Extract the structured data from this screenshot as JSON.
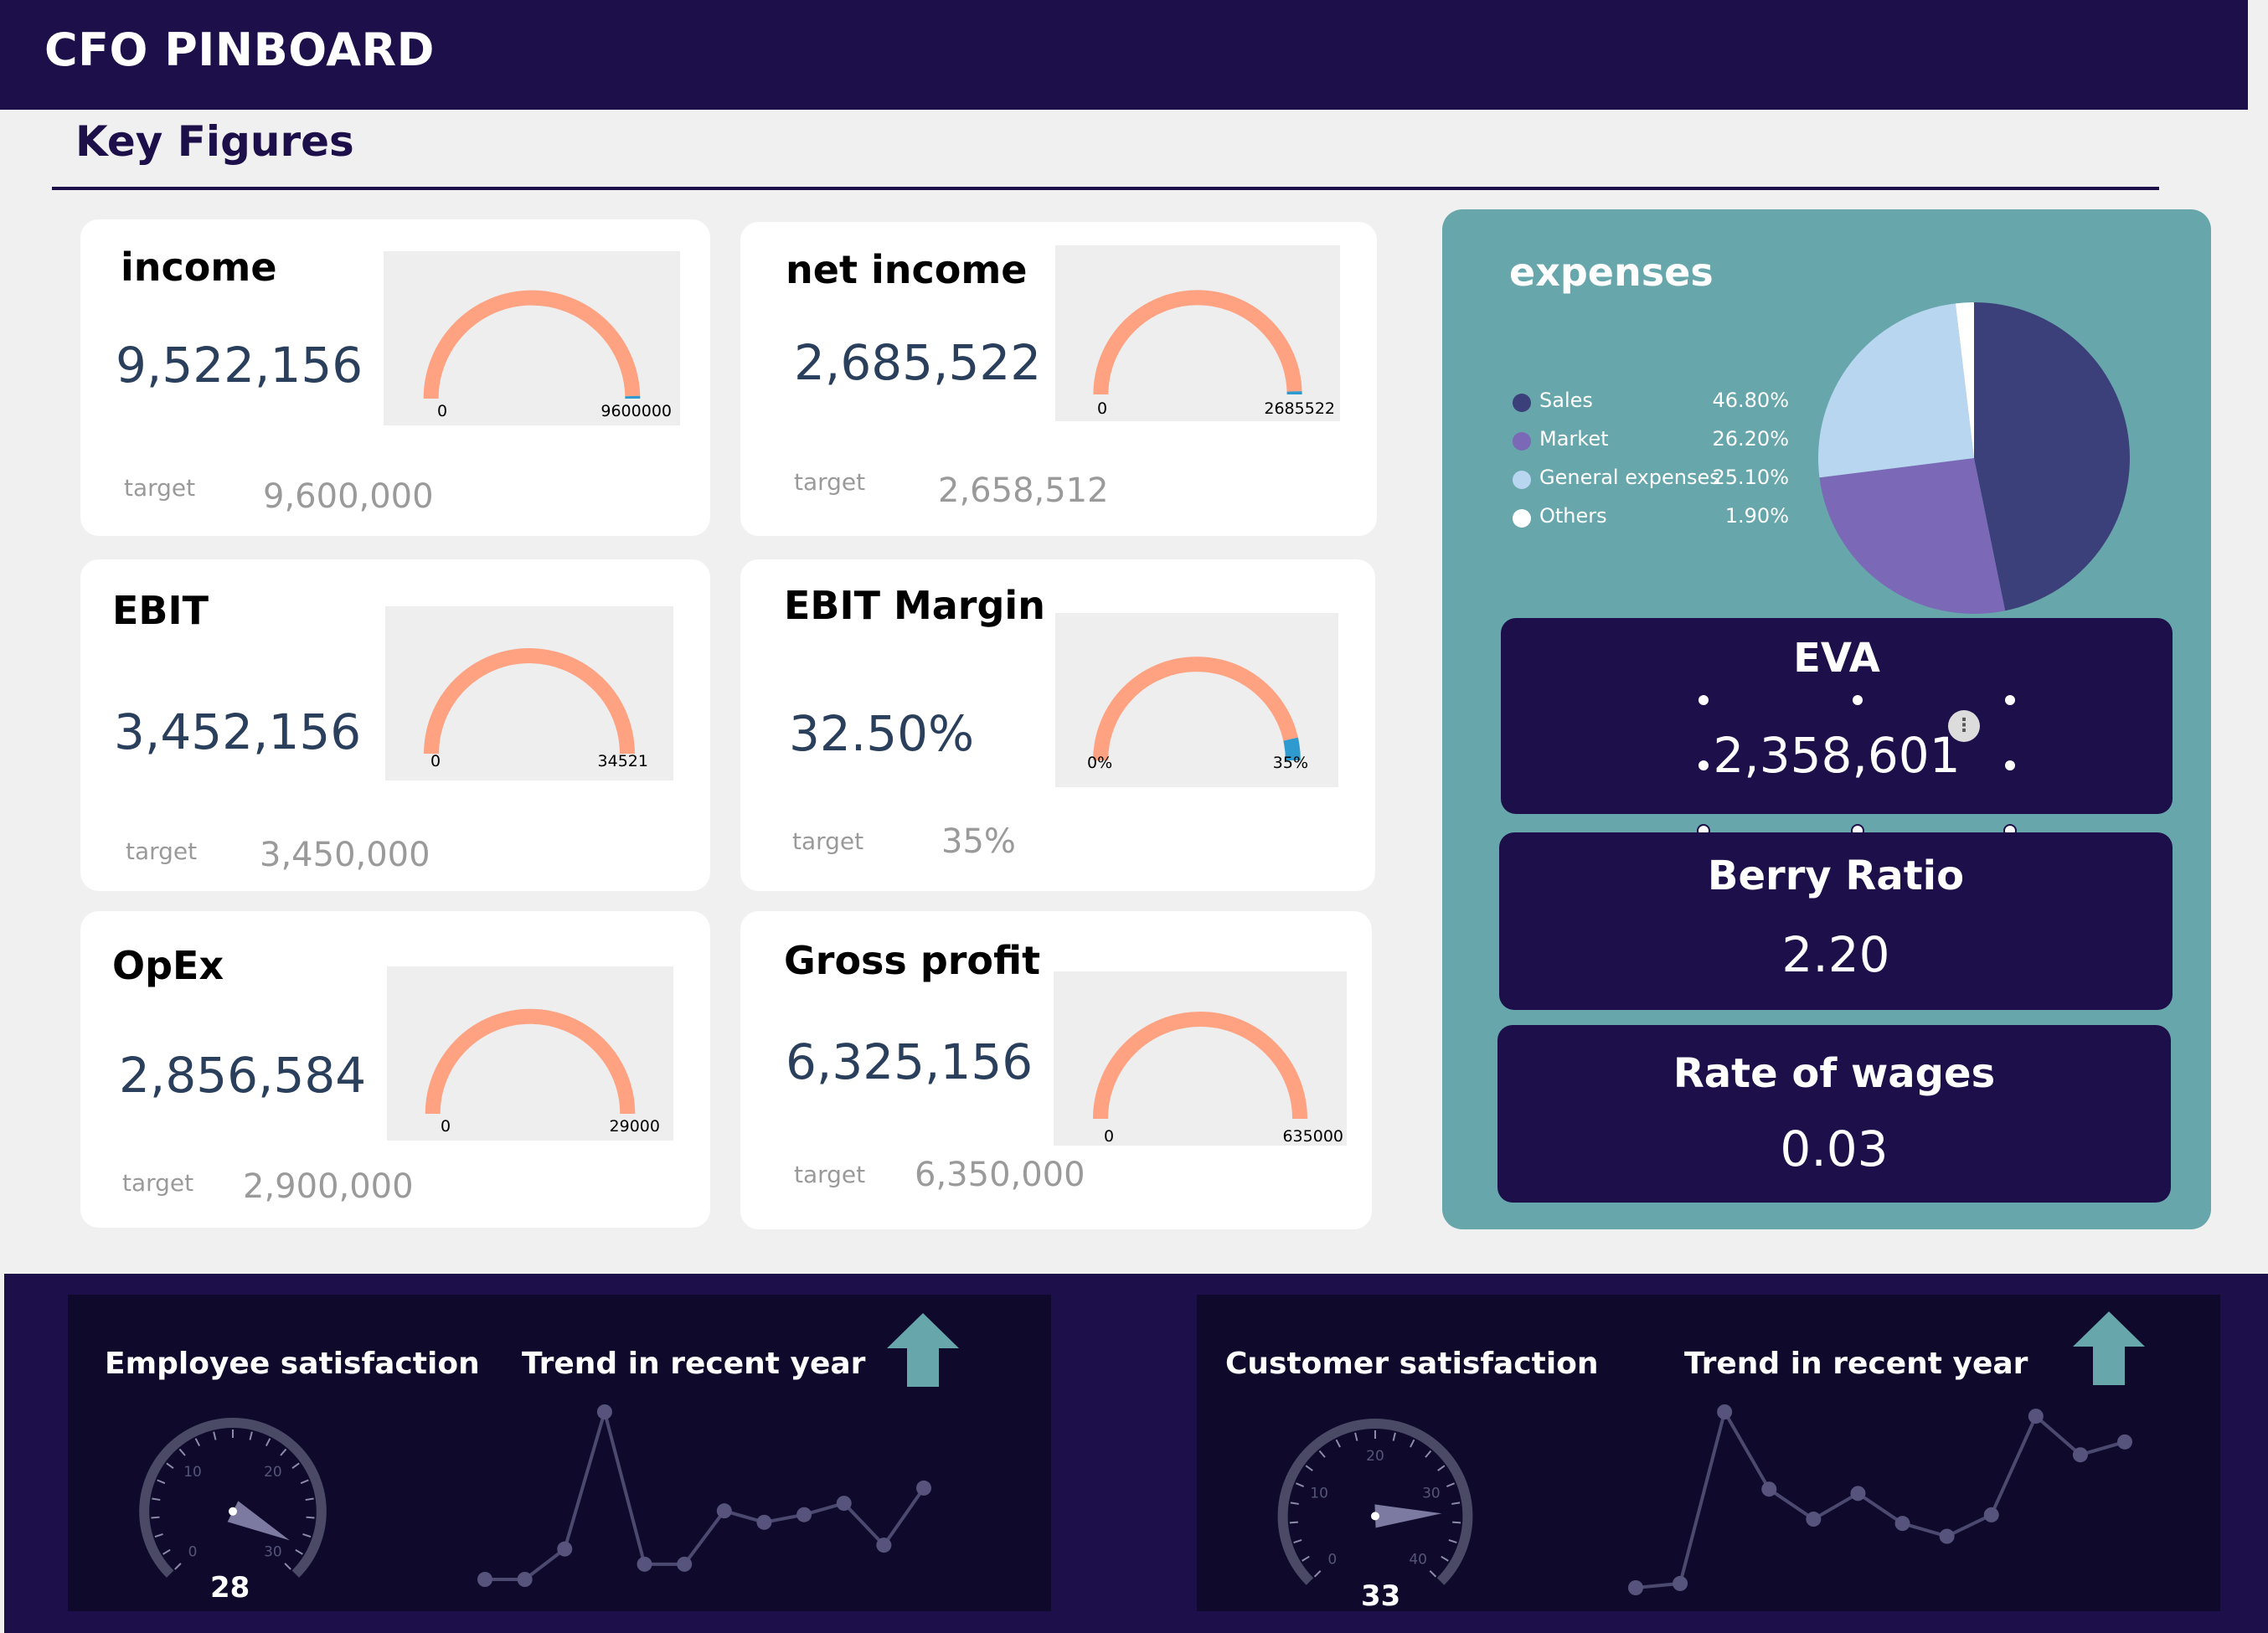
{
  "header": {
    "title": "CFO PINBOARD"
  },
  "section": {
    "title": "Key Figures"
  },
  "kpis": [
    {
      "title": "income",
      "value": "9,522,156",
      "target_label": "target",
      "target": "9,600,000",
      "gauge_min": "0",
      "gauge_max": "9600000",
      "progress": 0.992
    },
    {
      "title": "net income",
      "value": "2,685,522",
      "target_label": "target",
      "target": "2,658,512",
      "gauge_min": "0",
      "gauge_max": "2685522",
      "progress": 0.99
    },
    {
      "title": "EBIT",
      "value": "3,452,156",
      "target_label": "target",
      "target": "3,450,000",
      "gauge_min": "0",
      "gauge_max": "34521",
      "progress": 1.0
    },
    {
      "title": "EBIT Margin",
      "value": "32.50%",
      "target_label": "target",
      "target": "35%",
      "gauge_min": "0%",
      "gauge_max": "35%",
      "progress": 0.929
    },
    {
      "title": "OpEx",
      "value": "2,856,584",
      "target_label": "target",
      "target": "2,900,000",
      "gauge_min": "0",
      "gauge_max": "29000",
      "progress": 1.0
    },
    {
      "title": "Gross profit",
      "value": "6,325,156",
      "target_label": "target",
      "target": "6,350,000",
      "gauge_min": "0",
      "gauge_max": "635000",
      "progress": 1.0
    }
  ],
  "expenses": {
    "title": "expenses",
    "items": [
      {
        "label": "Sales",
        "pct": "46.80%",
        "value": 46.8,
        "color": "#3b3f7a"
      },
      {
        "label": "Market",
        "pct": "26.20%",
        "value": 26.2,
        "color": "#7b68b6"
      },
      {
        "label": "General expenses",
        "pct": "25.10%",
        "value": 25.1,
        "color": "#b9d6f0"
      },
      {
        "label": "Others",
        "pct": "1.90%",
        "value": 1.9,
        "color": "#ffffff"
      }
    ]
  },
  "metrics": {
    "eva": {
      "title": "EVA",
      "value": "2,358,601",
      "more_icon": "⋮"
    },
    "berry": {
      "title": "Berry Ratio",
      "value": "2.20"
    },
    "wages": {
      "title": "Rate of wages",
      "value": "0.03"
    }
  },
  "employee": {
    "title": "Employee satisfaction",
    "trend_title": "Trend in recent year",
    "value": "28",
    "dial_value": 28,
    "dial_min": 0,
    "dial_max": 30,
    "ticks": [
      "0",
      "10",
      "20",
      "30"
    ],
    "trend_icon": "arrow-up-icon",
    "trend": [
      4,
      4,
      12,
      48,
      8,
      8,
      22,
      19,
      21,
      24,
      13,
      28
    ]
  },
  "customer": {
    "title": "Customer satisfaction",
    "trend_title": "Trend in recent year",
    "value": "33",
    "dial_value": 33,
    "dial_min": 0,
    "dial_max": 40,
    "ticks": [
      "0",
      "10",
      "20",
      "30",
      "40"
    ],
    "trend_icon": "arrow-up-icon",
    "trend": [
      4,
      5,
      45,
      27,
      20,
      26,
      19,
      16,
      21,
      44,
      35,
      38
    ]
  },
  "colors": {
    "navy": "#1c0f4a",
    "teal": "#67a6ab",
    "gauge": "#ffa281",
    "gauge_over": "#2e9ad0",
    "arrow": "#67a6ab"
  }
}
